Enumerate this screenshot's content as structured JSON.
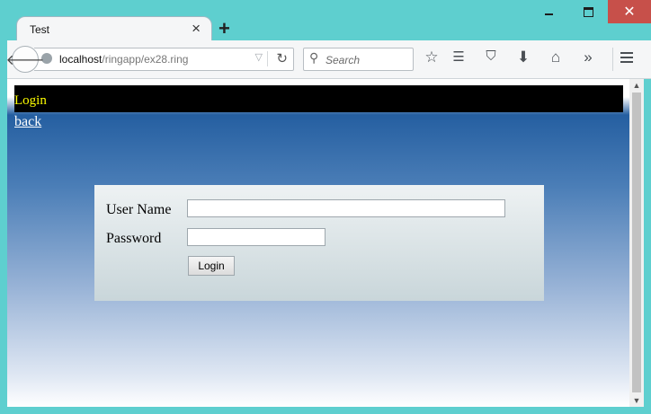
{
  "browser": {
    "tab_title": "Test",
    "url_host": "localhost",
    "url_path": "/ringapp/ex28.ring",
    "search_placeholder": "Search"
  },
  "page": {
    "header_title": "Login",
    "back_link": "back",
    "form": {
      "username_label": "User Name",
      "username_value": "",
      "password_label": "Password",
      "password_value": "",
      "submit_label": "Login"
    }
  },
  "icons": {
    "window": [
      "minimize-icon",
      "maximize-icon",
      "close-icon"
    ],
    "toolbar": [
      "back-arrow-icon",
      "globe-icon",
      "dropdown-icon",
      "reload-icon",
      "search-icon",
      "bookmark-star-icon",
      "reading-list-icon",
      "pocket-icon",
      "download-icon",
      "home-icon",
      "overflow-icon",
      "menu-icon"
    ]
  },
  "colors": {
    "header_bg": "#000000",
    "header_text": "#ffff00",
    "gradient_top": "#255fa1",
    "gradient_bottom": "#ffffff",
    "window_frame": "#5ecfcf",
    "close_button": "#c7504a"
  }
}
